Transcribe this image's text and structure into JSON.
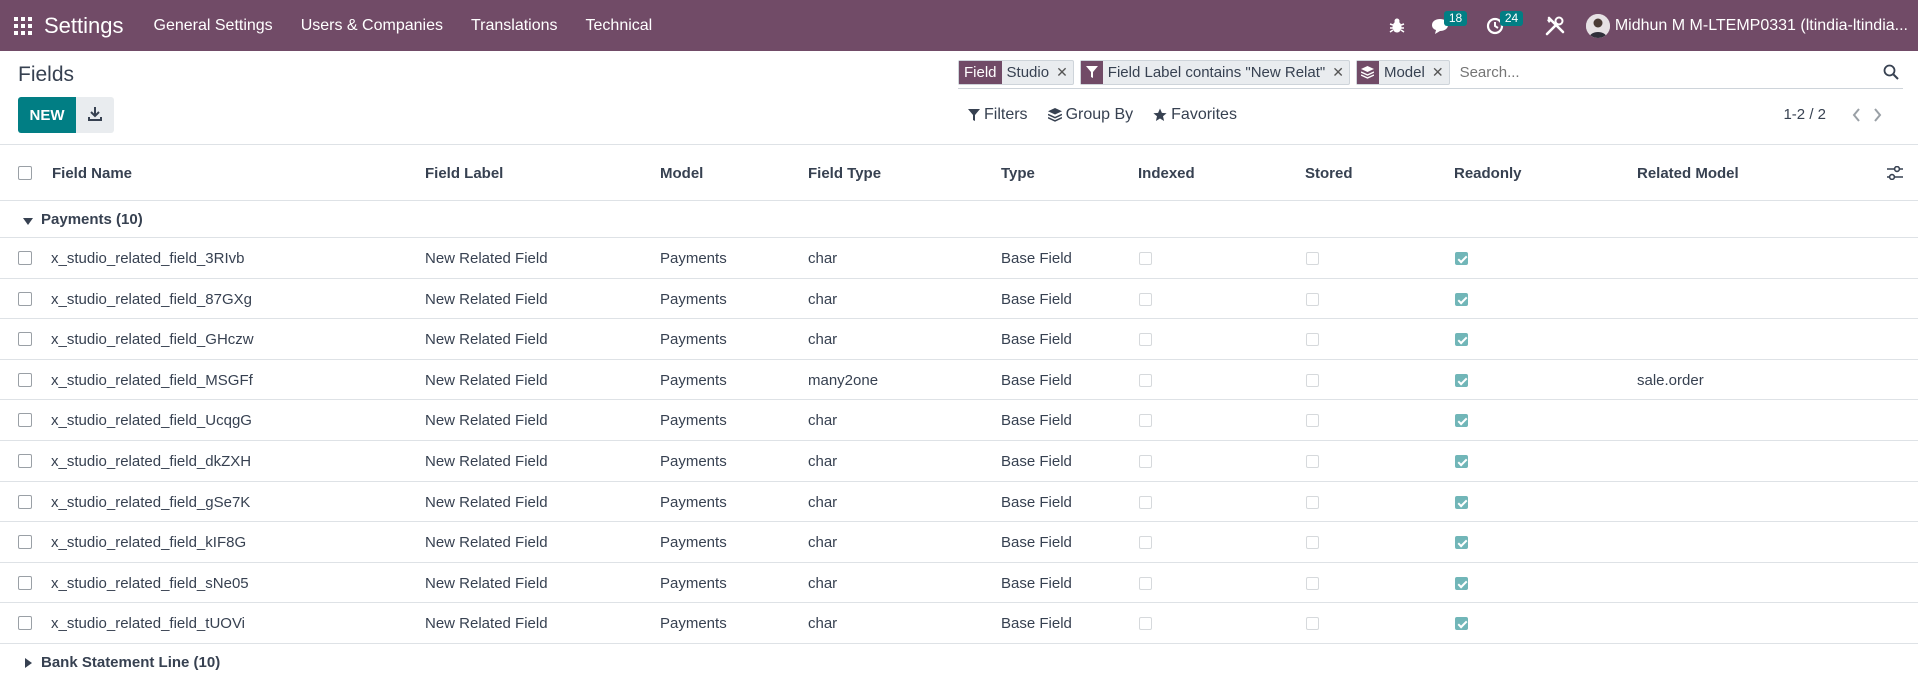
{
  "navbar": {
    "brand": "Settings",
    "menu": [
      "General Settings",
      "Users & Companies",
      "Translations",
      "Technical"
    ],
    "messages_count": "18",
    "activities_count": "24",
    "user_name": "Midhun M M-LTEMP0331 (ltindia-ltindia..."
  },
  "control": {
    "title": "Fields",
    "new_label": "NEW",
    "search_placeholder": "Search...",
    "facets": [
      {
        "label": "Field",
        "value": "Studio"
      },
      {
        "value": "Field Label contains \"New Relat\""
      },
      {
        "value": "Model"
      }
    ],
    "filters_label": "Filters",
    "groupby_label": "Group By",
    "favorites_label": "Favorites",
    "pager": "1-2 / 2"
  },
  "table": {
    "columns": [
      "Field Name",
      "Field Label",
      "Model",
      "Field Type",
      "Type",
      "Indexed",
      "Stored",
      "Readonly",
      "Related Model"
    ],
    "groups": [
      {
        "label": "Payments (10)",
        "open": true,
        "rows": [
          {
            "name": "x_studio_related_field_3RIvb",
            "label": "New Related Field",
            "model": "Payments",
            "ftype": "char",
            "type": "Base Field",
            "indexed": false,
            "stored": false,
            "readonly": true,
            "related": ""
          },
          {
            "name": "x_studio_related_field_87GXg",
            "label": "New Related Field",
            "model": "Payments",
            "ftype": "char",
            "type": "Base Field",
            "indexed": false,
            "stored": false,
            "readonly": true,
            "related": ""
          },
          {
            "name": "x_studio_related_field_GHczw",
            "label": "New Related Field",
            "model": "Payments",
            "ftype": "char",
            "type": "Base Field",
            "indexed": false,
            "stored": false,
            "readonly": true,
            "related": ""
          },
          {
            "name": "x_studio_related_field_MSGFf",
            "label": "New Related Field",
            "model": "Payments",
            "ftype": "many2one",
            "type": "Base Field",
            "indexed": false,
            "stored": false,
            "readonly": true,
            "related": "sale.order"
          },
          {
            "name": "x_studio_related_field_UcqgG",
            "label": "New Related Field",
            "model": "Payments",
            "ftype": "char",
            "type": "Base Field",
            "indexed": false,
            "stored": false,
            "readonly": true,
            "related": ""
          },
          {
            "name": "x_studio_related_field_dkZXH",
            "label": "New Related Field",
            "model": "Payments",
            "ftype": "char",
            "type": "Base Field",
            "indexed": false,
            "stored": false,
            "readonly": true,
            "related": ""
          },
          {
            "name": "x_studio_related_field_gSe7K",
            "label": "New Related Field",
            "model": "Payments",
            "ftype": "char",
            "type": "Base Field",
            "indexed": false,
            "stored": false,
            "readonly": true,
            "related": ""
          },
          {
            "name": "x_studio_related_field_kIF8G",
            "label": "New Related Field",
            "model": "Payments",
            "ftype": "char",
            "type": "Base Field",
            "indexed": false,
            "stored": false,
            "readonly": true,
            "related": ""
          },
          {
            "name": "x_studio_related_field_sNe05",
            "label": "New Related Field",
            "model": "Payments",
            "ftype": "char",
            "type": "Base Field",
            "indexed": false,
            "stored": false,
            "readonly": true,
            "related": ""
          },
          {
            "name": "x_studio_related_field_tUOVi",
            "label": "New Related Field",
            "model": "Payments",
            "ftype": "char",
            "type": "Base Field",
            "indexed": false,
            "stored": false,
            "readonly": true,
            "related": ""
          }
        ]
      },
      {
        "label": "Bank Statement Line (10)",
        "open": false,
        "rows": []
      }
    ]
  },
  "colors": {
    "navbar": "#714b67",
    "primary": "#017e84",
    "checked": "#71b6b8"
  }
}
